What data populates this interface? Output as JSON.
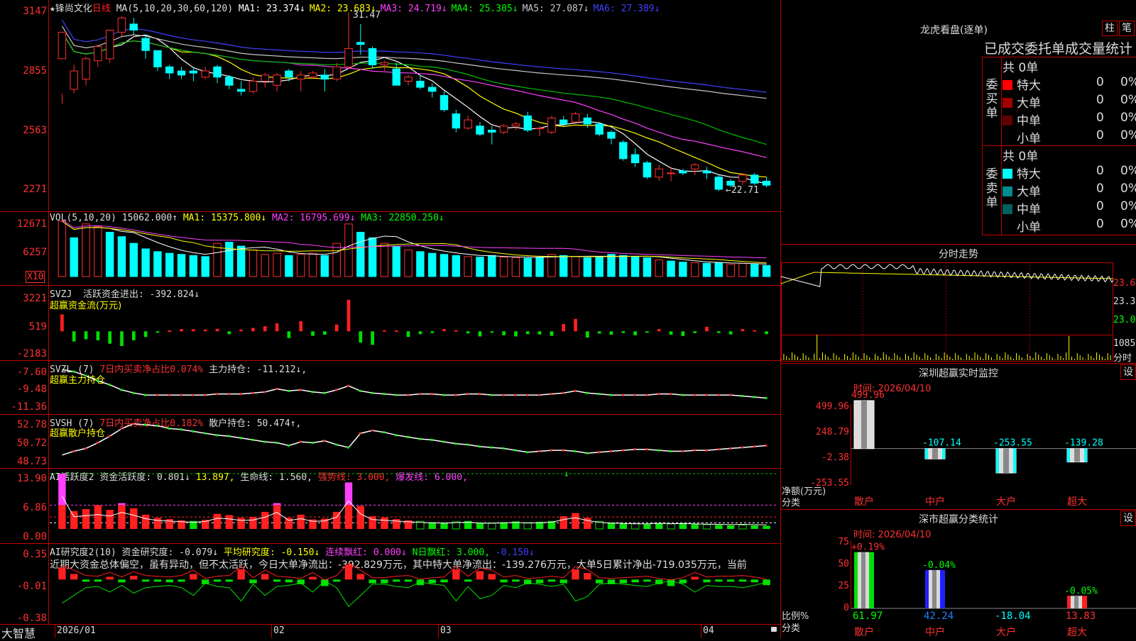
{
  "main_chart": {
    "star": "★",
    "stock_name": "锋尚文化",
    "period": "日线",
    "ma_params": "MA(5,10,20,30,60,120)",
    "ma_values": [
      {
        "label": "MA1:",
        "value": "23.374↓",
        "color": "#ffffff"
      },
      {
        "label": "MA2:",
        "value": "23.683↓",
        "color": "#ffff00"
      },
      {
        "label": "MA3:",
        "value": "24.719↓",
        "color": "#ff40ff"
      },
      {
        "label": "MA4:",
        "value": "25.305↓",
        "color": "#00ff00"
      },
      {
        "label": "MA5:",
        "value": "27.087↓",
        "color": "#c8c8c8"
      },
      {
        "label": "MA6:",
        "value": "27.389↓",
        "color": "#4040ff"
      }
    ],
    "y_ticks": [
      "3147",
      "2855",
      "2563",
      "2271"
    ],
    "high_label": "31.47",
    "low_label": "←22.71",
    "x_labels": [
      "2026/01",
      "02",
      "03",
      "04"
    ]
  },
  "vol_panel": {
    "title": "VOL(5,10,20)",
    "value": "15062.000↑",
    "ma1": "MA1: 15375.800↓",
    "ma2": "MA2: 16795.699↓",
    "ma3": "MA3: 22850.250↓",
    "y_ticks": [
      "12671",
      "6257"
    ],
    "unit": "X10"
  },
  "svzj_panel": {
    "title": "SVZJ",
    "metric": "活跃资金进出: -392.824↓",
    "subtitle": "超赢资金流(万元)",
    "y_ticks": [
      "3221",
      "519",
      "-2183"
    ]
  },
  "svzl_panel": {
    "title": "SVZL (7)",
    "metric1": "7日内买卖净占比0.074%",
    "metric2": "主力持仓: -11.212↓,",
    "subtitle": "超赢主力持仓",
    "y_ticks": [
      "-7.60",
      "-9.48",
      "-11.36"
    ]
  },
  "svsh_panel": {
    "title": "SVSH (7)",
    "metric1": "7日内买卖净占比0.182%",
    "metric2": "散户持仓: 50.474↑,",
    "subtitle": "超赢散户持仓",
    "y_ticks": [
      "52.78",
      "50.72",
      "48.73"
    ]
  },
  "ai_active_panel": {
    "title": "AI活跃度2",
    "metric1": "资金活跃度: 0.801↓",
    "metric2": "13.897,",
    "metric3": "生命线: 1.560,",
    "metric4": "强势线: 3.000,",
    "metric5": "爆发线: 6.000,",
    "arrow": "↓",
    "y_ticks": [
      "13.90",
      "6.86",
      "0.00"
    ]
  },
  "ai_research_panel": {
    "title": "AI研究度2(10)",
    "metric1": "资金研究度: -0.079↓",
    "metric2": "平均研究度: -0.150↓",
    "metric3": "连续飘红: 0.000↓",
    "metric4": "N日飘红: 3.000,",
    "metric5": "-0.150↓",
    "summary": "近期大资金总体偏空，虽有异动，但不太活跃，今日大单净流出：-392.829万元，其中特大单净流出：-139.276万元，大单5日累计净出-719.035万元，当前",
    "y_ticks": [
      "0.35",
      "-0.01",
      "-0.38"
    ]
  },
  "brand": "大智慧",
  "lhb": {
    "title": "龙虎看盘(逐单)",
    "btn1": "柱",
    "btn2": "笔",
    "header": "已成交委托单成交量统计",
    "buy_label": "委买单",
    "sell_label": "委卖单",
    "buy_total": "共 0单",
    "sell_total": "共 0单",
    "buy_rows": [
      {
        "name": "特大",
        "count": "0",
        "pct": "0%",
        "color": "#ff0000"
      },
      {
        "name": "大单",
        "count": "0",
        "pct": "0%",
        "color": "#a00000"
      },
      {
        "name": "中单",
        "count": "0",
        "pct": "0%",
        "color": "#600000"
      },
      {
        "name": "小单",
        "count": "0",
        "pct": "0%",
        "color": "#000000"
      }
    ],
    "sell_rows": [
      {
        "name": "特大",
        "count": "0",
        "pct": "0%",
        "color": "#00ffff"
      },
      {
        "name": "大单",
        "count": "0",
        "pct": "0%",
        "color": "#008c8c"
      },
      {
        "name": "中单",
        "count": "0",
        "pct": "0%",
        "color": "#006060"
      },
      {
        "name": "小单",
        "count": "0",
        "pct": "0%",
        "color": "#000000"
      }
    ]
  },
  "intraday": {
    "title": "分时走势",
    "price_ticks": [
      "23.64",
      "23.35",
      "23.06"
    ],
    "vol_tick": "1085",
    "vol_unit": "分时"
  },
  "sz_monitor": {
    "title": "深圳超赢实时监控",
    "btn": "设",
    "time": "时间: 2026/04/10",
    "y_ticks": [
      "499.96",
      "248.79",
      "-2.38",
      "-253.55"
    ],
    "y_caption1": "净额(万元)",
    "y_caption2": "分类",
    "bars": [
      {
        "cat": "散户",
        "value": 499.96,
        "label": "499.96"
      },
      {
        "cat": "中户",
        "value": -107.14,
        "label": "-107.14"
      },
      {
        "cat": "大户",
        "value": -253.55,
        "label": "-253.55"
      },
      {
        "cat": "超大",
        "value": -139.28,
        "label": "-139.28"
      }
    ]
  },
  "sz_class": {
    "title": "深市超赢分类统计",
    "btn": "设",
    "time": "时间: 2026/04/10",
    "y_ticks": [
      "75",
      "50",
      "25",
      "0"
    ],
    "y_caption1": "比例%",
    "y_caption2": "分类",
    "bars": [
      {
        "cat": "散户",
        "value": 61.97,
        "top_label": "+0.19%",
        "bottom_label": "61.97"
      },
      {
        "cat": "中户",
        "value": 42.24,
        "top_label": "-0.04%",
        "bottom_label": "42.24"
      },
      {
        "cat": "大户",
        "value": -18.04,
        "top_label": "",
        "bottom_label": "-18.04"
      },
      {
        "cat": "超大",
        "value": 13.83,
        "top_label": "-0.05%",
        "bottom_label": "13.83"
      }
    ]
  },
  "chart_data": {
    "type": "candlestick",
    "price_range": [
      22.71,
      31.47
    ],
    "candles": [
      [
        29.2,
        30.5,
        27.5,
        27.0
      ],
      [
        27.7,
        28.6,
        28.9,
        27.5
      ],
      [
        28.2,
        29.2,
        29.3,
        27.9
      ],
      [
        29.1,
        29.8,
        29.9,
        28.8
      ],
      [
        29.2,
        30.6,
        30.6,
        29.0
      ],
      [
        30.5,
        31.2,
        31.3,
        30.3
      ],
      [
        30.9,
        30.6,
        31.2,
        30.4
      ],
      [
        30.2,
        29.6,
        30.4,
        29.2
      ],
      [
        29.6,
        28.8,
        29.6,
        28.6
      ],
      [
        28.8,
        28.5,
        28.9,
        28.2
      ],
      [
        28.6,
        28.4,
        28.8,
        28.2
      ],
      [
        28.6,
        28.5,
        28.8,
        28.1
      ],
      [
        28.3,
        28.6,
        28.8,
        28.2
      ],
      [
        28.8,
        28.3,
        28.9,
        28.0
      ],
      [
        28.3,
        27.9,
        28.4,
        27.7
      ],
      [
        27.7,
        27.6,
        28.1,
        27.4
      ],
      [
        27.6,
        28.1,
        28.3,
        27.5
      ],
      [
        28.1,
        28.4,
        28.5,
        27.8
      ],
      [
        27.9,
        28.4,
        28.5,
        27.6
      ],
      [
        28.6,
        28.3,
        28.7,
        28.1
      ],
      [
        28.2,
        28.4,
        28.6,
        27.6
      ],
      [
        28.3,
        28.5,
        28.6,
        28.2
      ],
      [
        28.4,
        28.2,
        28.7,
        27.6
      ],
      [
        28.2,
        28.8,
        29.0,
        28.1
      ],
      [
        28.8,
        29.7,
        31.47,
        28.7
      ],
      [
        30.0,
        29.9,
        30.9,
        29.4
      ],
      [
        29.7,
        28.9,
        29.8,
        28.7
      ],
      [
        28.9,
        29.0,
        29.1,
        28.6
      ],
      [
        28.7,
        27.9,
        29.0,
        27.9
      ],
      [
        28.1,
        28.3,
        28.4,
        27.9
      ],
      [
        28.1,
        27.8,
        28.4,
        27.7
      ],
      [
        27.8,
        27.6,
        28.0,
        27.3
      ],
      [
        27.4,
        26.7,
        27.6,
        26.6
      ],
      [
        26.5,
        25.8,
        26.7,
        25.6
      ],
      [
        25.8,
        26.2,
        26.4,
        25.7
      ],
      [
        25.9,
        25.5,
        26.1,
        25.4
      ],
      [
        25.7,
        25.6,
        25.9,
        25.0
      ],
      [
        25.6,
        25.9,
        26.0,
        25.5
      ],
      [
        25.9,
        26.0,
        26.1,
        25.7
      ],
      [
        26.4,
        25.7,
        26.6,
        25.6
      ],
      [
        25.8,
        25.8,
        25.9,
        25.4
      ],
      [
        25.6,
        26.3,
        26.4,
        25.5
      ],
      [
        26.2,
        26.0,
        26.4,
        25.9
      ],
      [
        26.1,
        26.5,
        26.6,
        26.0
      ],
      [
        26.3,
        26.0,
        26.5,
        25.8
      ],
      [
        26.0,
        25.5,
        26.1,
        25.4
      ],
      [
        25.6,
        25.3,
        25.7,
        25.0
      ],
      [
        25.1,
        24.3,
        25.2,
        24.2
      ],
      [
        24.5,
        24.1,
        24.8,
        23.9
      ],
      [
        24.1,
        23.4,
        24.2,
        23.3
      ],
      [
        23.4,
        23.8,
        24.0,
        23.2
      ],
      [
        23.6,
        23.6,
        23.9,
        23.2
      ],
      [
        23.7,
        23.6,
        23.8,
        23.5
      ],
      [
        23.8,
        24.0,
        24.1,
        23.5
      ],
      [
        23.7,
        23.6,
        23.9,
        23.3
      ],
      [
        23.4,
        22.8,
        23.5,
        22.71
      ],
      [
        23.2,
        23.0,
        23.3,
        22.9
      ],
      [
        23.2,
        23.5,
        23.6,
        23.0
      ],
      [
        23.5,
        23.1,
        23.6,
        23.0
      ],
      [
        23.2,
        23.0,
        23.4,
        22.9
      ]
    ],
    "volume": [
      100,
      70,
      95,
      90,
      80,
      72,
      60,
      50,
      45,
      42,
      40,
      38,
      36,
      60,
      62,
      55,
      48,
      40,
      42,
      38,
      40,
      42,
      38,
      60,
      95,
      80,
      70,
      60,
      55,
      48,
      45,
      42,
      40,
      38,
      36,
      35,
      38,
      35,
      34,
      33,
      35,
      40,
      38,
      36,
      34,
      35,
      40,
      38,
      36,
      34,
      30,
      28,
      26,
      25,
      24,
      25,
      22,
      24,
      22,
      20
    ],
    "vol_up": [
      true,
      false,
      true,
      true,
      false,
      false,
      false,
      false,
      false,
      false,
      false,
      false,
      false,
      true,
      false,
      false,
      true,
      true,
      true,
      false,
      true,
      true,
      false,
      true,
      true,
      false,
      false,
      true,
      false,
      true,
      false,
      false,
      false,
      false,
      true,
      false,
      false,
      true,
      true,
      false,
      false,
      true,
      false,
      true,
      false,
      false,
      false,
      false,
      false,
      false,
      true,
      false,
      false,
      true,
      false,
      false,
      true,
      true,
      false,
      false
    ],
    "svzj": [
      1500,
      -900,
      -700,
      -800,
      -1100,
      -1300,
      -800,
      -500,
      -100,
      80,
      200,
      180,
      150,
      220,
      -250,
      150,
      300,
      450,
      700,
      -600,
      900,
      -400,
      -300,
      600,
      2800,
      -1000,
      -1200,
      100,
      80,
      -500,
      -250,
      -150,
      200,
      100,
      -180,
      -450,
      -100,
      -350,
      -450,
      -250,
      -280,
      -400,
      650,
      1100,
      -550,
      -200,
      -300,
      -150,
      -350,
      -100,
      200,
      -300,
      -420,
      -160,
      400,
      -150,
      -280,
      200,
      100,
      -250
    ],
    "svzl": [
      -8.1,
      -8.3,
      -8.7,
      -9.2,
      -9.6,
      -10.1,
      -10.4,
      -10.6,
      -10.6,
      -10.6,
      -10.6,
      -10.6,
      -10.6,
      -10.5,
      -10.5,
      -10.5,
      -10.4,
      -10.3,
      -10.0,
      -10.2,
      -10.1,
      -10.3,
      -10.4,
      -10.1,
      -9.7,
      -10.2,
      -10.4,
      -10.5,
      -10.6,
      -10.6,
      -10.5,
      -10.5,
      -10.6,
      -10.6,
      -10.5,
      -10.5,
      -10.6,
      -10.6,
      -10.6,
      -10.6,
      -10.6,
      -10.5,
      -10.4,
      -10.2,
      -10.4,
      -10.5,
      -10.6,
      -10.6,
      -10.6,
      -10.6,
      -10.5,
      -10.5,
      -10.6,
      -10.6,
      -10.6,
      -10.6,
      -10.6,
      -10.7,
      -10.8,
      -10.9
    ],
    "svsh": [
      49.2,
      49.6,
      49.9,
      50.5,
      51.2,
      52.0,
      52.5,
      52.4,
      52.3,
      52.0,
      51.9,
      51.7,
      51.5,
      51.3,
      51.2,
      51.0,
      50.8,
      50.6,
      50.5,
      50.2,
      50.6,
      50.5,
      50.7,
      50.3,
      50.0,
      51.5,
      51.8,
      51.6,
      51.3,
      51.1,
      50.9,
      50.8,
      50.6,
      50.4,
      50.3,
      50.1,
      50.0,
      49.9,
      49.7,
      49.5,
      49.6,
      49.7,
      49.7,
      49.6,
      49.4,
      49.5,
      49.6,
      49.7,
      49.8,
      49.8,
      49.7,
      49.6,
      49.6,
      49.7,
      49.7,
      49.8,
      49.9,
      50.0,
      50.1,
      50.2
    ],
    "active": [
      13.9,
      4.5,
      5.0,
      5.5,
      4.8,
      6.5,
      5.2,
      3.6,
      2.8,
      2.5,
      2.2,
      2.0,
      2.3,
      3.8,
      3.5,
      2.8,
      3.0,
      4.3,
      6.5,
      2.8,
      3.6,
      2.4,
      2.6,
      4.3,
      11.7,
      5.8,
      3.2,
      2.9,
      2.5,
      2.2,
      1.9,
      1.7,
      1.6,
      1.8,
      2.0,
      1.6,
      1.5,
      1.7,
      1.9,
      1.6,
      1.8,
      2.0,
      3.2,
      4.0,
      2.8,
      1.9,
      1.6,
      1.4,
      1.3,
      1.2,
      1.5,
      1.3,
      1.4,
      1.2,
      1.1,
      1.0,
      0.9,
      1.0,
      0.9,
      0.8
    ],
    "active_magenta": [
      true,
      false,
      false,
      true,
      false,
      true,
      false,
      false,
      false,
      false,
      false,
      false,
      false,
      false,
      false,
      false,
      false,
      false,
      true,
      false,
      false,
      false,
      false,
      false,
      true,
      false,
      false,
      false,
      false,
      false,
      false,
      false,
      false,
      false,
      false,
      false,
      false,
      false,
      false,
      false,
      false,
      false,
      false,
      false,
      false,
      false,
      false,
      false,
      false,
      false,
      false,
      false,
      false,
      false,
      false,
      false,
      false,
      false,
      false,
      false
    ],
    "research": [
      0.12,
      0.05,
      -0.02,
      -0.03,
      0.02,
      -0.04,
      0.03,
      -0.02,
      -0.03,
      -0.04,
      -0.02,
      0.05,
      -0.06,
      -0.03,
      -0.02,
      0.1,
      -0.05,
      0.05,
      -0.03,
      -0.04,
      -0.06,
      0.02,
      -0.08,
      -0.02,
      0.15,
      0.05,
      -0.05,
      -0.05,
      -0.03,
      -0.02,
      -0.07,
      -0.05,
      -0.04,
      0.1,
      -0.03,
      0.08,
      0.05,
      -0.04,
      -0.02,
      -0.06,
      -0.05,
      -0.03,
      -0.05,
      0.1,
      0.06,
      -0.05,
      -0.06,
      -0.05,
      -0.04,
      -0.03,
      -0.06,
      -0.08,
      -0.05,
      0.02,
      -0.04,
      -0.03,
      -0.03,
      -0.02,
      -0.04,
      -0.07
    ]
  }
}
